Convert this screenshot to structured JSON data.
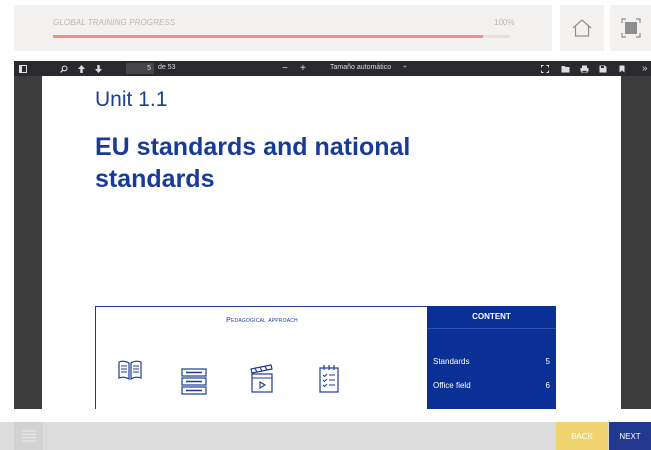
{
  "progress": {
    "label": "GLOBAL TRAINING PROGRESS",
    "percent_text": "100%",
    "value": 0.94,
    "fill_color": "#ef8f86"
  },
  "header_icons": {
    "home": "home-icon",
    "fullscreen": "fullscreen-icon"
  },
  "pdf_toolbar": {
    "current_page": "5",
    "page_of": "de 53",
    "zoom_minus": "−",
    "zoom_plus": "+",
    "zoom_label": "Tamaño automático",
    "zoom_caret": "÷",
    "tools_overflow": "»"
  },
  "page": {
    "unit": "Unit 1.1",
    "title": "EU standards and national standards",
    "pedagogical_title": "Pedagogical approach",
    "content": {
      "header": "CONTENT",
      "rows": [
        {
          "label": "Standards",
          "value": "5"
        },
        {
          "label": "Office field",
          "value": "6"
        }
      ]
    }
  },
  "nav": {
    "back_label": "BACK",
    "next_label": "NEXT"
  },
  "colors": {
    "brand_blue": "#1d3c91",
    "back_yellow": "#efd36f",
    "next_navy": "#23398f"
  }
}
